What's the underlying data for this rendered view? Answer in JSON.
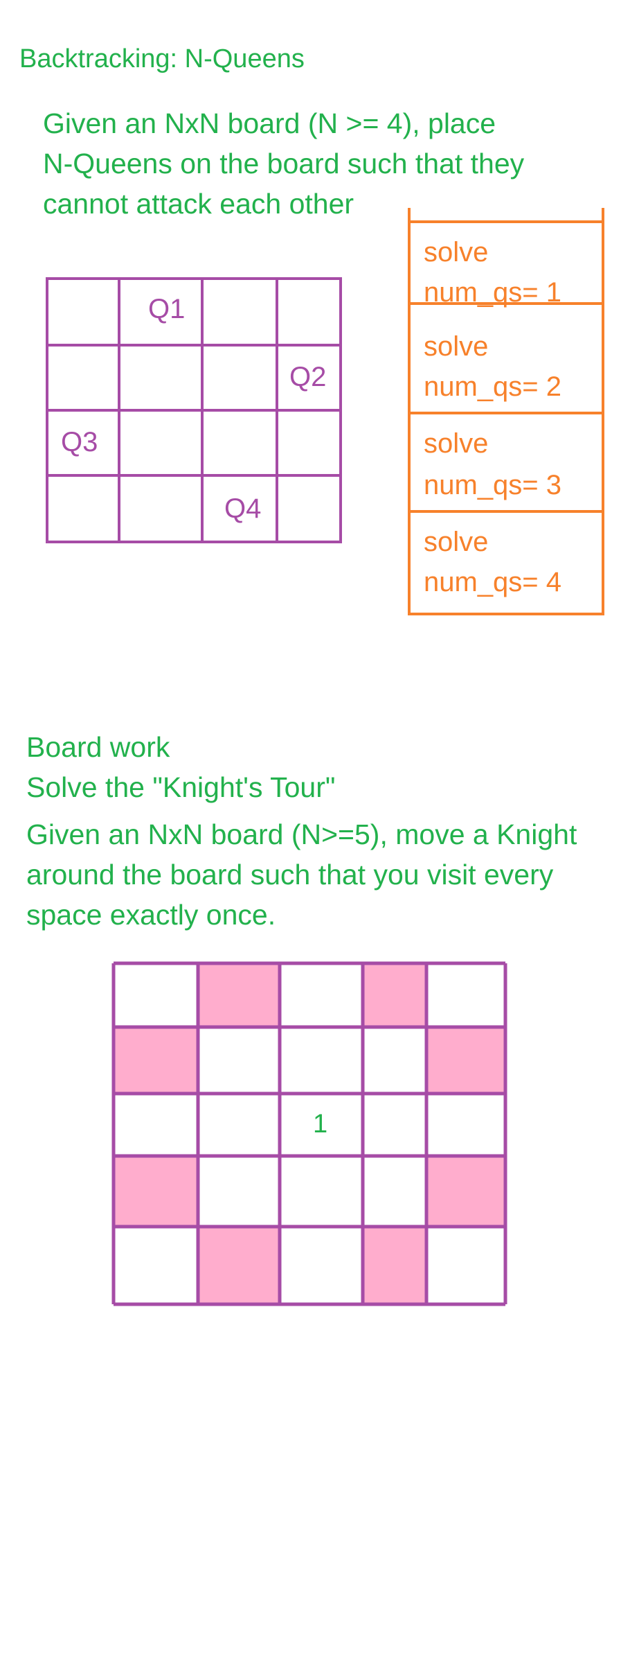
{
  "title": "Backtracking: N-Queens",
  "nqueens": {
    "description": [
      "Given an NxN board (N >= 4), place",
      "N-Queens on the board such that they",
      "cannot attack each other"
    ],
    "queens": [
      {
        "label": "Q1",
        "row": 0,
        "col": 1
      },
      {
        "label": "Q2",
        "row": 1,
        "col": 3
      },
      {
        "label": "Q3",
        "row": 2,
        "col": 0
      },
      {
        "label": "Q4",
        "row": 3,
        "col": 2
      }
    ]
  },
  "call_stack": {
    "frames": [
      {
        "fn": "solve",
        "var": "num_qs= 1"
      },
      {
        "fn": "solve",
        "var": "num_qs= 2"
      },
      {
        "fn": "solve",
        "var": "num_qs= 3"
      },
      {
        "fn": "solve",
        "var": "num_qs= 4"
      }
    ]
  },
  "board_work": {
    "heading": "Board work",
    "task": "Solve the \"Knight's Tour\"",
    "description": [
      "Given an NxN board (N>=5), move a Knight",
      "around the board such that you visit every",
      "space exactly once."
    ],
    "knight_board": {
      "size": 5,
      "start_mark": {
        "label": "1",
        "row": 2,
        "col": 2
      },
      "highlighted_cells": [
        [
          0,
          1
        ],
        [
          0,
          3
        ],
        [
          1,
          0
        ],
        [
          1,
          4
        ],
        [
          3,
          0
        ],
        [
          3,
          4
        ],
        [
          4,
          1
        ],
        [
          4,
          3
        ]
      ],
      "highlight_color": "#ffadcd",
      "grid_color": "#a64ca6"
    }
  },
  "colors": {
    "green": "#22b14c",
    "orange": "#f7812b",
    "purple": "#a64ca6"
  }
}
